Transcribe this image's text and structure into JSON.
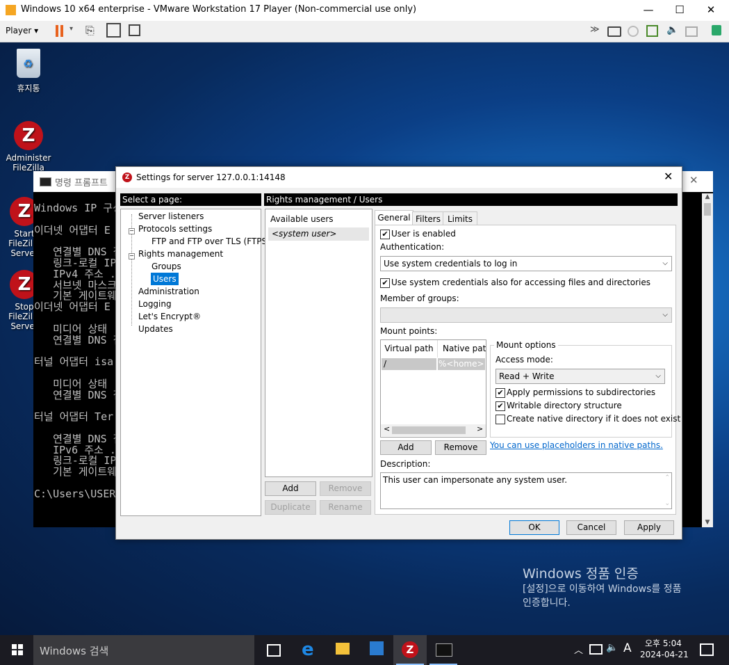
{
  "vmware": {
    "title": "Windows 10 x64 enterprise - VMware Workstation 17 Player (Non-commercial use only)",
    "player_menu": "Player",
    "minimize": "—",
    "maximize": "☐",
    "close": "✕"
  },
  "desktop": {
    "icons": [
      {
        "label": "휴지통"
      },
      {
        "label": "Administer FileZilla"
      },
      {
        "label": "Start FileZilla Server"
      },
      {
        "label": "Stop FileZilla Server"
      }
    ],
    "activation_title": "Windows 정품 인증",
    "activation_line1": "[설정]으로 이동하여 Windows를 정품",
    "activation_line2": "인증합니다."
  },
  "console": {
    "title": "명령 프롬프트",
    "lines": [
      "Windows IP 구성",
      "",
      "이더넷 어댑터 E",
      "",
      "   연결별 DNS 접",
      "   링크-로컬 IP",
      "   IPv4 주소 .",
      "   서브넷 마스크",
      "   기본 게이트웨",
      "이더넷 어댑터 E",
      "",
      "   미디어 상태",
      "   연결별 DNS 접",
      "",
      "터널 어댑터 isa",
      "",
      "   미디어 상태",
      "   연결별 DNS 접",
      "",
      "터널 어댑터 Ter",
      "",
      "   연결별 DNS 접",
      "   IPv6 주소 .",
      "   링크-로컬 IP",
      "   기본 게이트웨",
      "",
      "C:\\Users\\USER>"
    ]
  },
  "dialog": {
    "title": "Settings for server 127.0.0.1:14148",
    "select_page_header": "Select a page:",
    "content_header": "Rights management / Users",
    "tree": [
      {
        "label": "Server listeners",
        "level": 0
      },
      {
        "label": "Protocols settings",
        "level": 0
      },
      {
        "label": "FTP and FTP over TLS (FTPS)",
        "level": 1
      },
      {
        "label": "Rights management",
        "level": 0
      },
      {
        "label": "Groups",
        "level": 1
      },
      {
        "label": "Users",
        "level": 1,
        "selected": true
      },
      {
        "label": "Administration",
        "level": 0
      },
      {
        "label": "Logging",
        "level": 0
      },
      {
        "label": "Let's Encrypt®",
        "level": 0
      },
      {
        "label": "Updates",
        "level": 0
      }
    ],
    "available_users_label": "Available users",
    "users": [
      "<system user>"
    ],
    "add_btn": "Add",
    "remove_btn": "Remove",
    "duplicate_btn": "Duplicate",
    "rename_btn": "Rename",
    "tabs": [
      "General",
      "Filters",
      "Limits"
    ],
    "user_enabled": "User is enabled",
    "authentication_label": "Authentication:",
    "authentication_value": "Use system credentials to log in",
    "use_system_credentials": "Use system credentials also for accessing files and directories",
    "member_of_groups": "Member of groups:",
    "mount_points": "Mount points:",
    "mount_columns": [
      "Virtual path",
      "Native path"
    ],
    "mount_rows": [
      {
        "virtual": "/",
        "native": "%<home>"
      }
    ],
    "mount_options": "Mount options",
    "access_mode_label": "Access mode:",
    "access_mode_value": "Read + Write",
    "apply_permissions": "Apply permissions to subdirectories",
    "writable_structure": "Writable directory structure",
    "create_native": "Create native directory if it does not exist",
    "mount_add": "Add",
    "mount_remove": "Remove",
    "placeholders_link": "You can use placeholders in native paths.",
    "description_label": "Description:",
    "description_value": "This user can impersonate any system user.",
    "ok": "OK",
    "cancel": "Cancel",
    "apply": "Apply"
  },
  "taskbar": {
    "search_placeholder": "Windows 검색",
    "ime": "A",
    "time": "오후 5:04",
    "date": "2024-04-21"
  }
}
